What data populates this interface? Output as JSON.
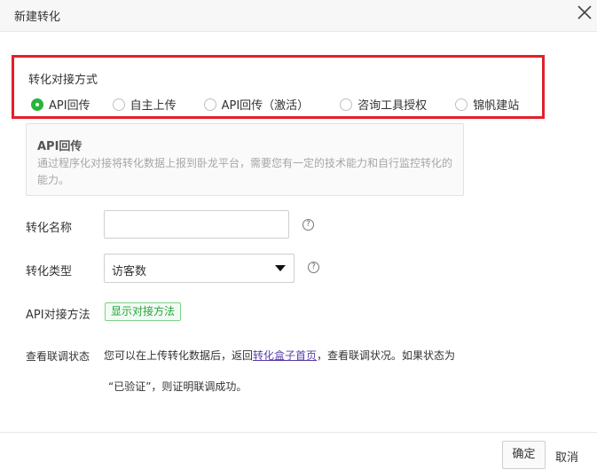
{
  "dialog": {
    "title": "新建转化"
  },
  "method": {
    "label": "转化对接方式",
    "options": [
      {
        "label": "API回传",
        "checked": true
      },
      {
        "label": "自主上传",
        "checked": false
      },
      {
        "label": "API回传（激活）",
        "checked": false
      },
      {
        "label": "咨询工具授权",
        "checked": false
      },
      {
        "label": "锦帆建站",
        "checked": false
      }
    ]
  },
  "description": {
    "title": "API回传",
    "text": "通过程序化对接将转化数据上报到卧龙平台，需要您有一定的技术能力和自行监控转化的能力。"
  },
  "form": {
    "name_label": "转化名称",
    "name_value": "",
    "type_label": "转化类型",
    "type_value": "访客数",
    "api_method_label": "API对接方法",
    "api_method_button": "显示对接方法",
    "status_label": "查看联调状态",
    "status_prefix": "您可以在上传转化数据后，返回",
    "status_link": "转化盒子首页",
    "status_suffix": "，查看联调状况。如果状态为",
    "status_line2": "“已验证”，则证明联调成功。"
  },
  "footer": {
    "ok": "确定",
    "cancel": "取消"
  },
  "colors": {
    "accent_green": "#26b53a",
    "highlight_red": "#e3202a",
    "link_purple": "#5a3ea8"
  },
  "icons": {
    "close": "close-icon",
    "help": "help-icon",
    "caret": "caret-down-icon"
  }
}
